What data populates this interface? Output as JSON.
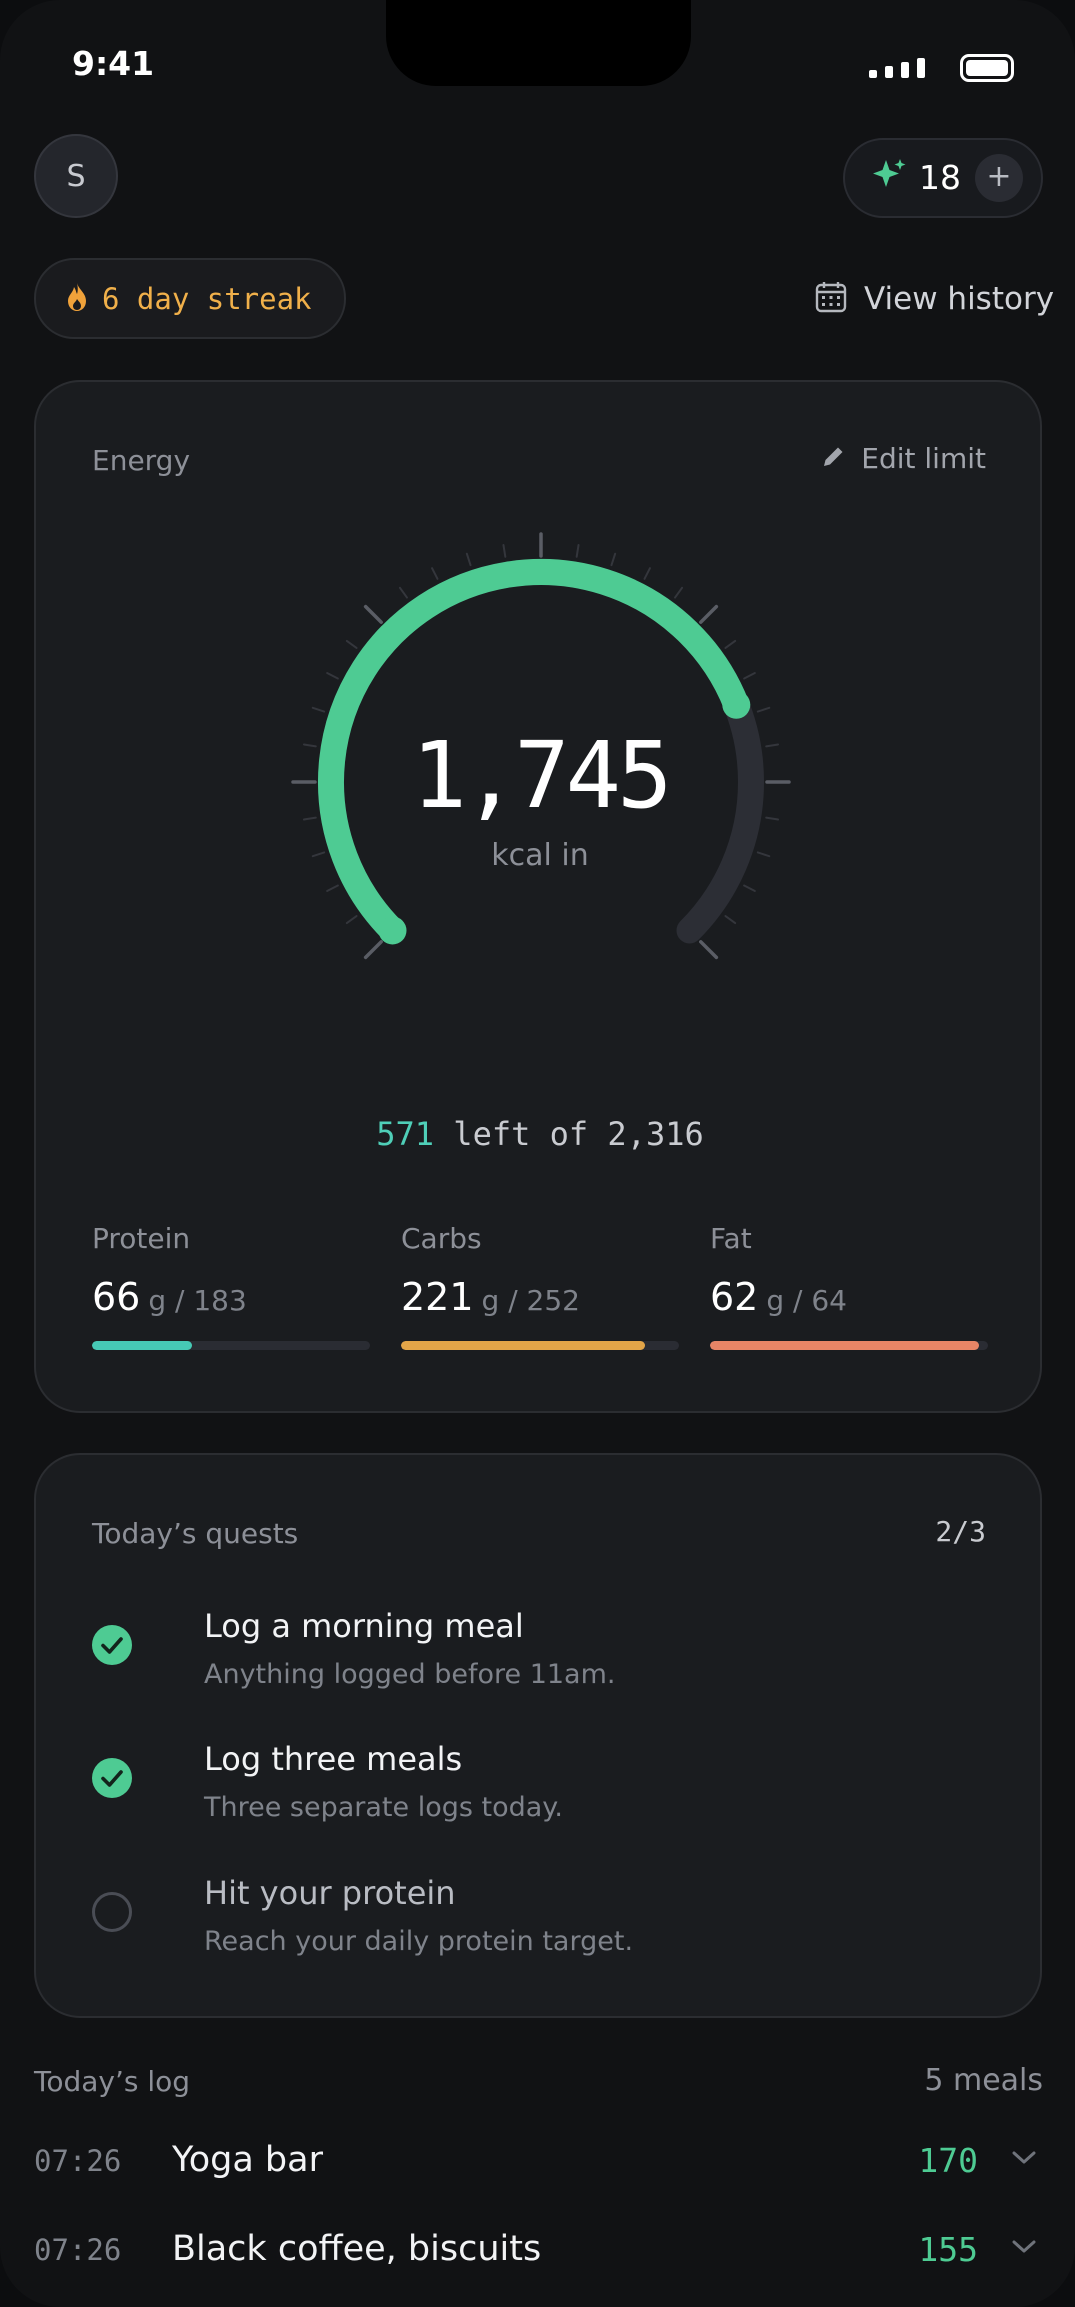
{
  "status_bar": {
    "time": "9:41"
  },
  "header": {
    "avatar_initial": "S",
    "credits": {
      "count": "18",
      "plus_label": "+",
      "icon": "sparkle-icon"
    },
    "streak": {
      "label": "6 day streak",
      "icon": "flame-icon"
    },
    "history": {
      "label": "View history",
      "icon": "calendar-icon"
    }
  },
  "energy": {
    "title": "Energy",
    "edit_label": "Edit limit",
    "value": "1,745",
    "unit": "kcal in",
    "remaining_value": "571",
    "remaining_text": "left of 2,316",
    "consumed": 1745,
    "limit": 2316,
    "macros": [
      {
        "name": "Protein",
        "value": "66",
        "target": "g / 183",
        "fraction": 0.36,
        "color": "#46c9b5"
      },
      {
        "name": "Carbs",
        "value": "221",
        "target": "g / 252",
        "fraction": 0.877,
        "color": "#e3a548"
      },
      {
        "name": "Fat",
        "value": "62",
        "target": "g / 64",
        "fraction": 0.969,
        "color": "#e88566"
      }
    ],
    "accent_color": "#4ecb93"
  },
  "quests": {
    "title": "Today’s quests",
    "count": "2/3",
    "items": [
      {
        "title": "Log a morning meal",
        "subtitle": "Anything logged before 11am.",
        "done": true
      },
      {
        "title": "Log three meals",
        "subtitle": "Three separate logs today.",
        "done": true
      },
      {
        "title": "Hit your protein",
        "subtitle": "Reach your daily protein target.",
        "done": false
      }
    ]
  },
  "log": {
    "title": "Today’s log",
    "count": "5 meals",
    "entries": [
      {
        "time": "07:26",
        "name": "Yoga bar",
        "kcal": "170"
      },
      {
        "time": "07:26",
        "name": "Black coffee, biscuits",
        "kcal": "155"
      }
    ]
  }
}
